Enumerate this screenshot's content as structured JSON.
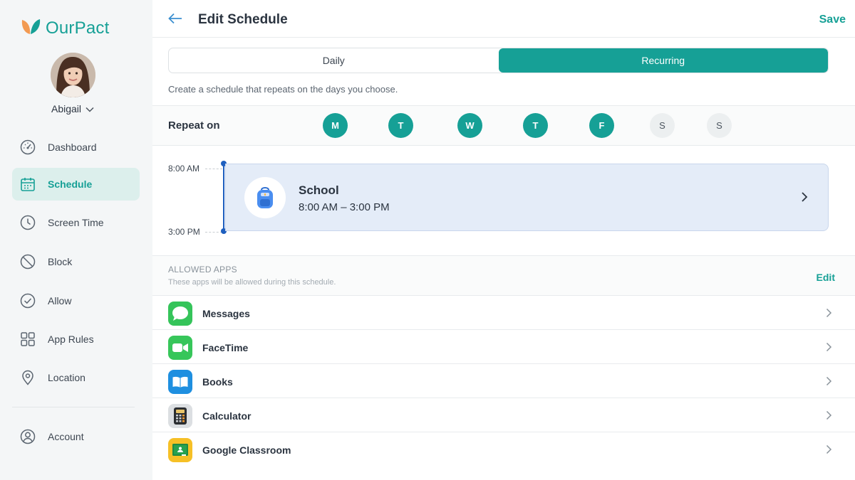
{
  "brand": {
    "name": "OurPact",
    "accent": "#16a096"
  },
  "profile": {
    "name": "Abigail"
  },
  "sidebar": {
    "items": [
      {
        "label": "Dashboard",
        "icon": "speedometer-icon"
      },
      {
        "label": "Schedule",
        "icon": "calendar-icon",
        "active": true
      },
      {
        "label": "Screen Time",
        "icon": "clock-icon"
      },
      {
        "label": "Block",
        "icon": "block-icon"
      },
      {
        "label": "Allow",
        "icon": "check-circle-icon"
      },
      {
        "label": "App Rules",
        "icon": "grid-icon"
      },
      {
        "label": "Location",
        "icon": "location-pin-icon"
      }
    ],
    "account": {
      "label": "Account",
      "icon": "user-circle-icon"
    }
  },
  "header": {
    "title": "Edit Schedule",
    "save_label": "Save"
  },
  "tabs": [
    {
      "label": "Daily"
    },
    {
      "label": "Recurring",
      "active": true
    }
  ],
  "subtitle": "Create a schedule that repeats on the days you choose.",
  "repeat": {
    "label": "Repeat on",
    "days": [
      {
        "letter": "M",
        "selected": true
      },
      {
        "letter": "T",
        "selected": true
      },
      {
        "letter": "W",
        "selected": true
      },
      {
        "letter": "T",
        "selected": true
      },
      {
        "letter": "F",
        "selected": true
      },
      {
        "letter": "S",
        "selected": false
      },
      {
        "letter": "S",
        "selected": false
      }
    ]
  },
  "timeline": {
    "start_label": "8:00 AM",
    "end_label": "3:00 PM",
    "event": {
      "title": "School",
      "time": "8:00 AM – 3:00 PM",
      "icon": "backpack-icon"
    }
  },
  "allowed_apps": {
    "title": "ALLOWED APPS",
    "subtitle": "These apps will be allowed during this schedule.",
    "edit_label": "Edit",
    "apps": [
      {
        "name": "Messages",
        "icon": "messages-icon"
      },
      {
        "name": "FaceTime",
        "icon": "facetime-icon"
      },
      {
        "name": "Books",
        "icon": "books-icon"
      },
      {
        "name": "Calculator",
        "icon": "calculator-icon"
      },
      {
        "name": "Google Classroom",
        "icon": "google-classroom-icon"
      }
    ]
  }
}
